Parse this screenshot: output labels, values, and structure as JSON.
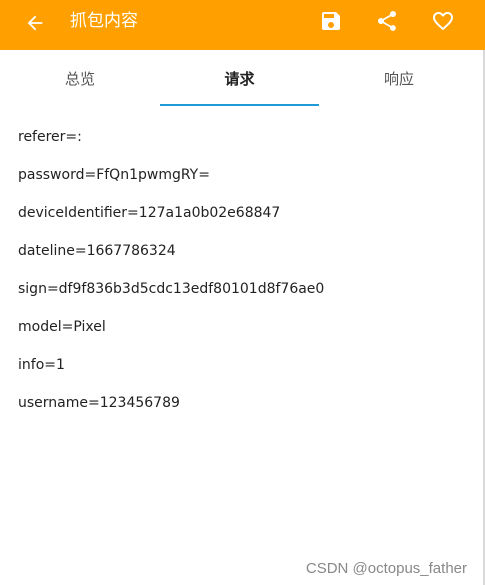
{
  "appbar": {
    "title": "抓包内容",
    "background": "#ffa000",
    "icons": [
      "back-arrow-icon",
      "save-icon",
      "share-icon",
      "heart-icon"
    ]
  },
  "tabs": [
    {
      "label": "总览"
    },
    {
      "label": "请求"
    },
    {
      "label": "响应"
    }
  ],
  "active_tab": "请求",
  "accent_color": "#1e9ad6",
  "params": [
    "referer=:",
    "password=FfQn1pwmgRY=",
    "deviceIdentifier=127a1a0b02e68847",
    "dateline=1667786324",
    "sign=df9f836b3d5cdc13edf80101d8f76ae0",
    "model=Pixel",
    "info=1",
    "username=123456789"
  ],
  "watermark": "CSDN @octopus_father"
}
